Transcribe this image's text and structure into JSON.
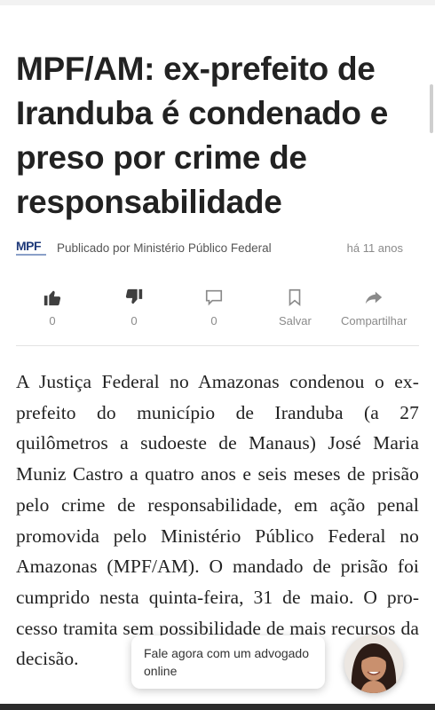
{
  "article": {
    "title": "MPF/AM: ex-prefeito de Iranduba é condenado e preso por crime de responsabilidade",
    "logo_text": "MPF",
    "published_by": "Publicado por Ministério Público Federal",
    "time_ago": "há 11 anos",
    "body": "A Justiça Federal no Amazonas condenou o ex-prefeito do município de Iranduba (a 27 quilômetros a sudoeste de Manaus) José Maria Muniz Castro a quatro anos e seis meses de prisão pelo crime de responsabili­dade, em ação penal promovida pelo Minis­tério Público Federal no Amazonas (MPF/AM). O mandado de prisão foi cum­prido nesta quinta-feira, 31 de maio. O pro­cesso tramita sem possibilidade de mais recursos da decisão."
  },
  "actions": {
    "like": {
      "icon": "thumbs-up-icon",
      "count": "0"
    },
    "dislike": {
      "icon": "thumbs-down-icon",
      "count": "0"
    },
    "comment": {
      "icon": "comment-icon",
      "count": "0"
    },
    "save": {
      "icon": "bookmark-icon",
      "label": "Salvar"
    },
    "share": {
      "icon": "share-arrow-icon",
      "label": "Compartilhar"
    }
  },
  "chat": {
    "message": "Fale agora com um advogado online"
  },
  "colors": {
    "text": "#222222",
    "muted": "#8a8a8a",
    "logo": "#1f3a7a"
  }
}
